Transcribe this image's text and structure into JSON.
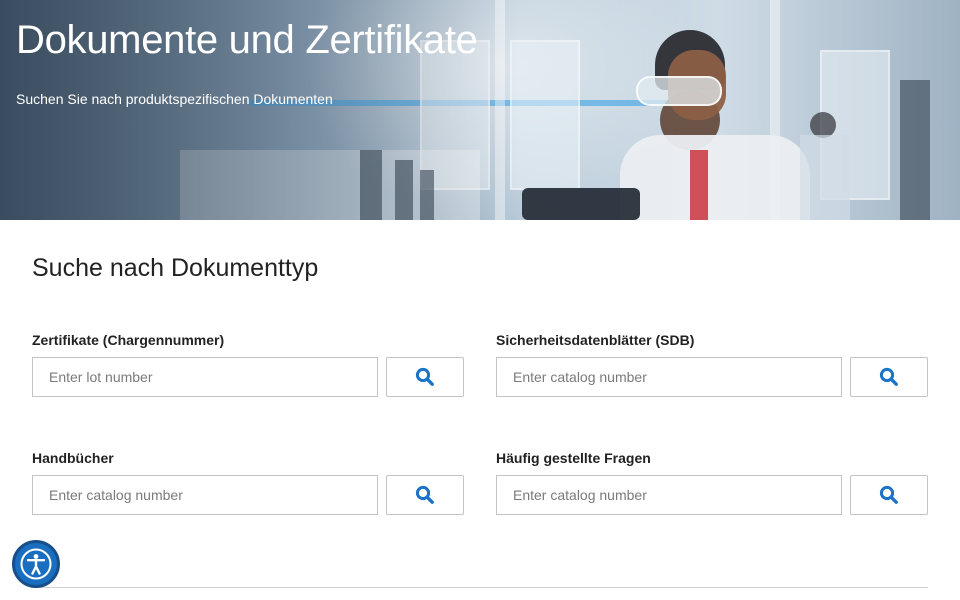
{
  "hero": {
    "title": "Dokumente und Zertifikate",
    "subtitle": "Suchen Sie nach produktspezifischen Dokumenten",
    "image": "laboratory scientist with safety goggles holding tablet"
  },
  "main": {
    "section_title": "Suche nach Dokumenttyp",
    "fields": [
      {
        "label": "Zertifikate (Chargennummer)",
        "placeholder": "Enter lot number",
        "value": "",
        "button_icon": "search-icon"
      },
      {
        "label": "Sicherheitsdatenblätter (SDB)",
        "placeholder": "Enter catalog number",
        "value": "",
        "button_icon": "search-icon"
      },
      {
        "label": "Handbücher",
        "placeholder": "Enter catalog number",
        "value": "",
        "button_icon": "search-icon"
      },
      {
        "label": "Häufig gestellte Fragen",
        "placeholder": "Enter catalog number",
        "value": "",
        "button_icon": "search-icon"
      }
    ]
  },
  "accessibility": {
    "icon": "accessibility-icon"
  },
  "colors": {
    "accent": "#1a6ec0",
    "search_icon": "#1a73c8",
    "border": "#c4c4c4"
  }
}
